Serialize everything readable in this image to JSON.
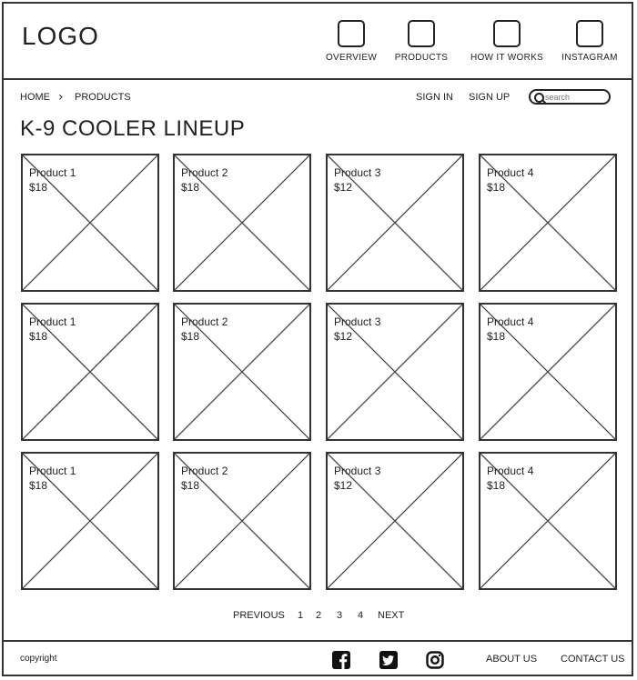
{
  "header": {
    "logo": "LOGO",
    "nav": [
      {
        "label": "OVERVIEW"
      },
      {
        "label": "PRODUCTS"
      },
      {
        "label": "HOW IT WORKS"
      },
      {
        "label": "INSTAGRAM"
      }
    ]
  },
  "breadcrumb": {
    "home": "HOME",
    "current": "PRODUCTS"
  },
  "auth": {
    "sign_in": "SIGN IN",
    "sign_up": "SIGN UP"
  },
  "search": {
    "placeholder": "search"
  },
  "page_title": "K-9 COOLER LINEUP",
  "products": [
    {
      "name": "Product 1",
      "price": "$18"
    },
    {
      "name": "Product 2",
      "price": "$18"
    },
    {
      "name": "Product 3",
      "price": "$12"
    },
    {
      "name": "Product 4",
      "price": "$18"
    },
    {
      "name": "Product 1",
      "price": "$18"
    },
    {
      "name": "Product 2",
      "price": "$18"
    },
    {
      "name": "Product 3",
      "price": "$12"
    },
    {
      "name": "Product 4",
      "price": "$18"
    },
    {
      "name": "Product 1",
      "price": "$18"
    },
    {
      "name": "Product 2",
      "price": "$18"
    },
    {
      "name": "Product 3",
      "price": "$12"
    },
    {
      "name": "Product 4",
      "price": "$18"
    }
  ],
  "pagination": {
    "previous": "PREVIOUS",
    "pages": [
      "1",
      "2",
      "3",
      "4"
    ],
    "next": "NEXT"
  },
  "footer": {
    "copyright": "copyright",
    "social": [
      "facebook-icon",
      "twitter-icon",
      "instagram-icon"
    ],
    "about": "ABOUT US",
    "contact": "CONTACT US"
  }
}
